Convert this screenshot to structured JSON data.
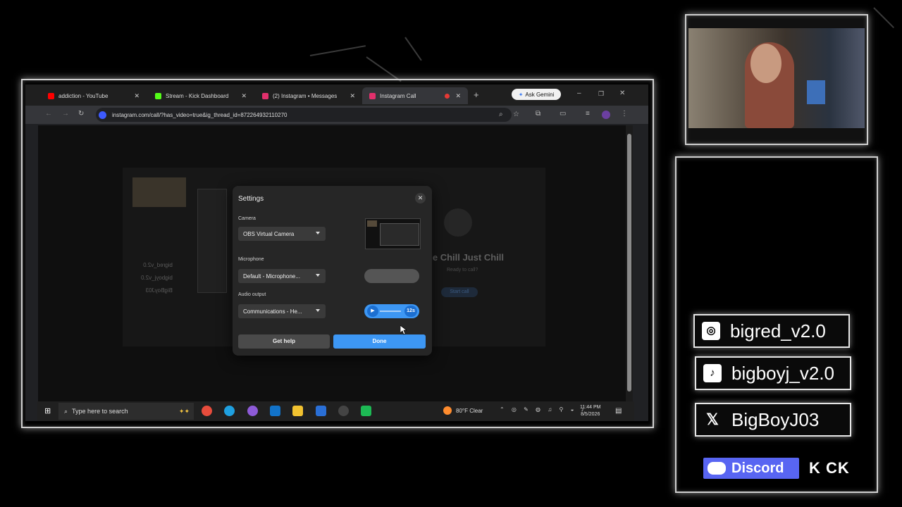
{
  "browser": {
    "tabs": [
      {
        "label": "addiction - YouTube",
        "color": "#ff0000"
      },
      {
        "label": "Stream - Kick Dashboard",
        "color": "#53fc18"
      },
      {
        "label": "(2) Instagram • Messages",
        "color": "#e1306c"
      },
      {
        "label": "Instagram Call",
        "color": "#e1306c"
      }
    ],
    "ask_gemini": "Ask Gemini",
    "url": "instagram.com/call/?has_video=true&ig_thread_id=872264932110270"
  },
  "background_call": {
    "name": "ude Chill Just Chill",
    "subtitle": "Ready to call?",
    "start_button": "Start call",
    "participants": [
      "bigred_v2.0",
      "bigboyj_v2.0",
      "BigBoyJ03"
    ]
  },
  "settings_dialog": {
    "title": "Settings",
    "camera_label": "Camera",
    "camera_value": "OBS Virtual Camera",
    "microphone_label": "Microphone",
    "microphone_value": "Default - Microphone...",
    "audio_label": "Audio output",
    "audio_value": "Communications - He...",
    "audio_test_time": "12s",
    "get_help": "Get help",
    "done": "Done"
  },
  "taskbar": {
    "search_placeholder": "Type here to search",
    "weather": "80°F Clear",
    "time": "11:44 PM",
    "date": "8/5/2026"
  },
  "overlay": {
    "socials": [
      {
        "icon": "instagram-icon",
        "handle": "bigred_v2.0"
      },
      {
        "icon": "tiktok-icon",
        "handle": "bigboyj_v2.0"
      },
      {
        "icon": "x-icon",
        "handle": "BigBoyJ03"
      }
    ],
    "discord_label": "Discord",
    "kick_label": "K CK"
  },
  "colors": {
    "accent_blue": "#3d97f4",
    "overlay_frame": "#cfcfcf"
  }
}
